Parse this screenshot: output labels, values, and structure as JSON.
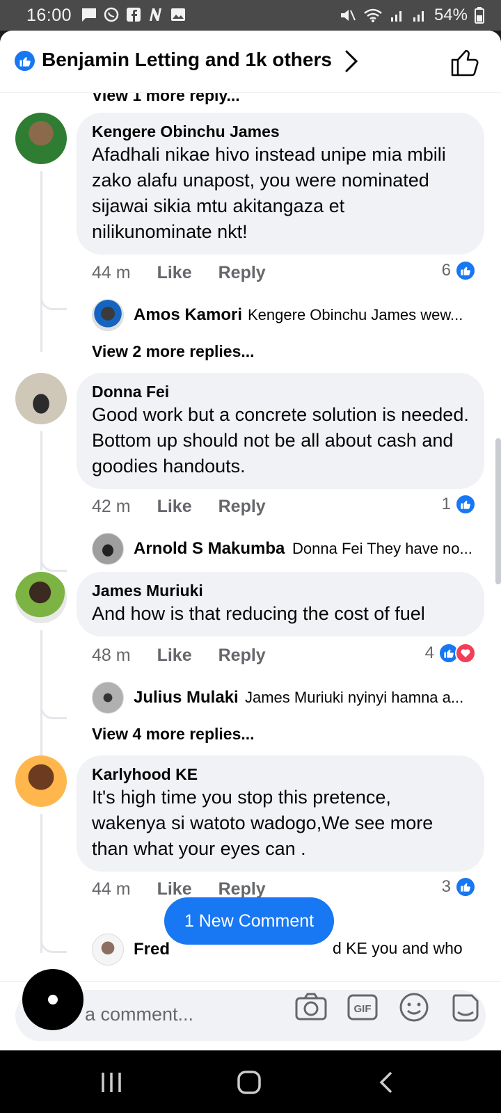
{
  "status_bar": {
    "time": "16:00",
    "battery": "54%",
    "left_icons": [
      "message-icon",
      "whatsapp-icon",
      "facebook-icon",
      "n-app-icon",
      "gallery-icon"
    ],
    "right_icons": [
      "mute-icon",
      "wifi-icon",
      "signal-icon",
      "signal-icon",
      "battery-icon"
    ]
  },
  "header": {
    "title": "Benjamin Letting and 1k others"
  },
  "feed": {
    "cut_off_reply": "View 1 more reply...",
    "comments": [
      {
        "author": "Kengere Obinchu James",
        "text": "Afadhali nikae hivo instead unipe mia mbili zako alafu unapost, you were nominated sijawai sikia mtu akitangaza et nilikunominate nkt!",
        "time": "44 m",
        "like": "Like",
        "reply": "Reply",
        "reaction_count": "6",
        "reactions": [
          "like"
        ],
        "reply_preview": {
          "name": "Amos Kamori",
          "snippet": "Kengere Obinchu James wew..."
        },
        "view_more": "View 2 more replies..."
      },
      {
        "author": "Donna Fei",
        "text": "Good work but a concrete solution is needed. Bottom up should not be all about cash and goodies handouts.",
        "time": "42 m",
        "like": "Like",
        "reply": "Reply",
        "reaction_count": "1",
        "reactions": [
          "like"
        ],
        "reply_preview": {
          "name": "Arnold S Makumba",
          "snippet": "Donna Fei They have no..."
        },
        "view_more": ""
      },
      {
        "author": "James Muriuki",
        "text": "And how is that reducing the cost of fuel",
        "time": "48 m",
        "like": "Like",
        "reply": "Reply",
        "reaction_count": "4",
        "reactions": [
          "like",
          "love"
        ],
        "reply_preview": {
          "name": "Julius Mulaki",
          "snippet": "James Muriuki nyinyi hamna a..."
        },
        "view_more": "View 4 more replies..."
      },
      {
        "author": "Karlyhood KE",
        "text": "It's high time you stop this pretence, wakenya si watoto wadogo,We see more than what your eyes can .",
        "time": "44 m",
        "like": "Like",
        "reply": "Reply",
        "reaction_count": "3",
        "reactions": [
          "like"
        ],
        "reply_preview": {
          "name": "Fred",
          "snippet": "d KE you and who"
        },
        "view_more": ""
      }
    ]
  },
  "new_comment_pill": "1 New Comment",
  "composer": {
    "placeholder": "a comment...",
    "icons": [
      "camera-icon",
      "gif-icon",
      "emoji-icon",
      "sticker-icon"
    ]
  },
  "colors": {
    "accent": "#1877f2",
    "love": "#f33e58",
    "bubble": "#f0f2f5",
    "muted_text": "#65676b"
  }
}
